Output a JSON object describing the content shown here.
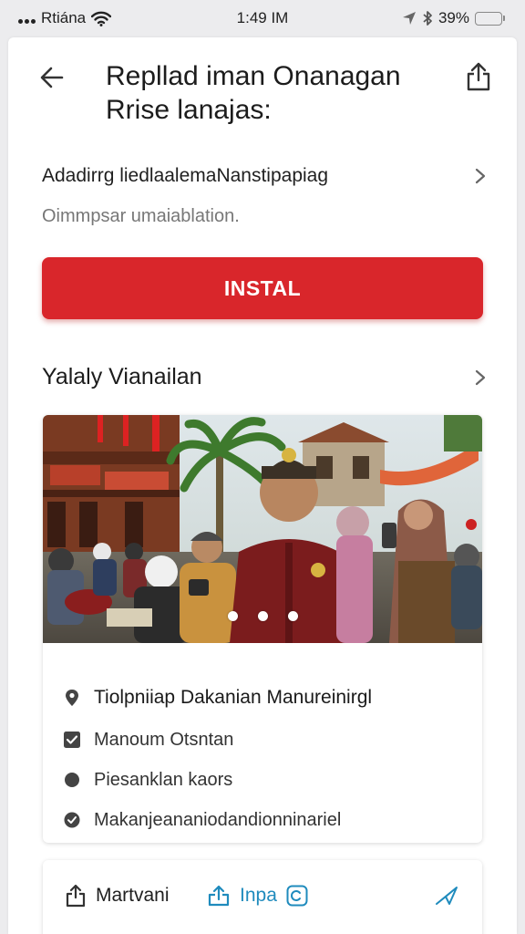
{
  "status_bar": {
    "carrier": "Rtiána",
    "time": "1:49 IM",
    "battery": "39%",
    "battery_level": 0.39,
    "icons": [
      "signal-dots-icon",
      "wifi-icon",
      "location-arrow-icon",
      "bluetooth-icon",
      "battery-icon"
    ]
  },
  "header": {
    "title_line1": "Repllad iman Onanagan",
    "title_line2": "Rrise lanajas:",
    "icons": [
      "back-arrow-icon",
      "share-icon"
    ]
  },
  "info_link": {
    "label": "Adadirrg liedlaalemaNanstipapiag",
    "subtitle": "Oimmpsar umaiablation.",
    "icon": "chevron-right-icon"
  },
  "install_button": {
    "label": "INSTAL",
    "color": "#d9262b"
  },
  "section": {
    "title": "Yalaly Vianailan",
    "icon": "chevron-right-icon"
  },
  "card": {
    "carousel": {
      "slides": 3,
      "active": 1
    },
    "location": "Tiolpniiap Dakanian Manureinirgl",
    "items": [
      {
        "label": "Manoum Otsntan",
        "icon": "checkbox-icon"
      },
      {
        "label": "Piesanklan kaors",
        "icon": "dot-icon"
      },
      {
        "label": "Makanjeananiodandionninariel",
        "icon": "check-circle-icon"
      }
    ]
  },
  "actions": [
    {
      "label": "Martvani",
      "icon": "share-up-icon"
    },
    {
      "label": "Inpa",
      "icon": "upload-icon"
    },
    {
      "label": "",
      "icon": "send-icon"
    }
  ],
  "colors": {
    "accent": "#d9262b",
    "link": "#1f8bbd",
    "battery": "#f2c21b"
  }
}
